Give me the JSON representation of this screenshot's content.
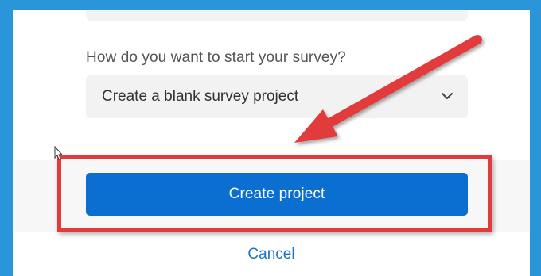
{
  "form": {
    "question_label": "How do you want to start your survey?",
    "select_value": "Create a blank survey project"
  },
  "actions": {
    "primary_label": "Create project",
    "cancel_label": "Cancel"
  },
  "icons": {
    "chevron": "chevron-down-icon",
    "arrow": "red-pointer-arrow",
    "cursor": "mouse-cursor-icon"
  },
  "colors": {
    "frame": "#2a95d8",
    "primary_button": "#0a6fd1",
    "highlight": "#e23b3b",
    "link": "#1a73c9"
  }
}
